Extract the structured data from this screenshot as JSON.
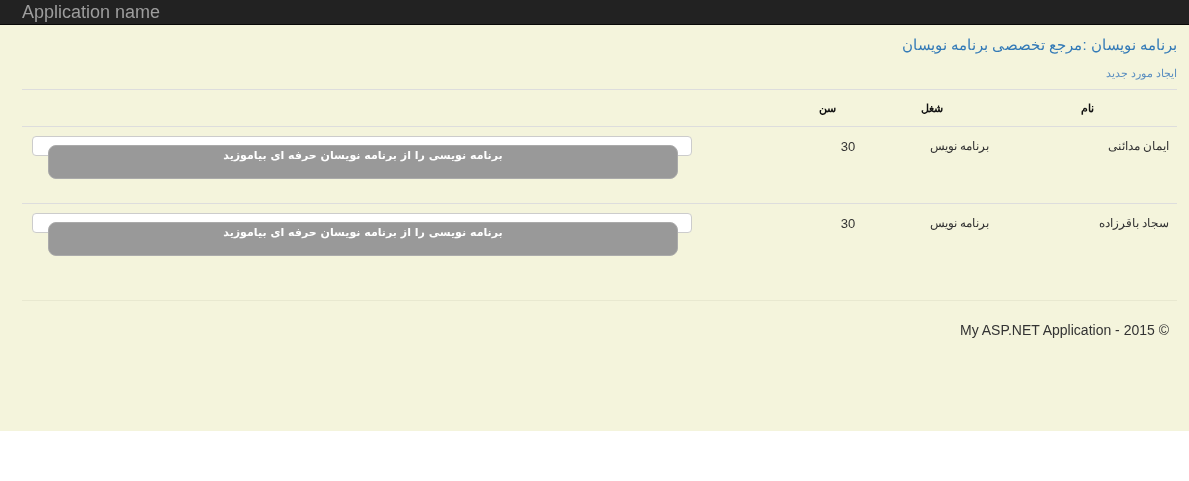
{
  "navbar": {
    "brand": "Application name"
  },
  "page": {
    "title": "برنامه نویسان :مرجع تخصصی برنامه نویسان",
    "create_link": "ایجاد مورد جدید"
  },
  "table": {
    "columns": [
      "نام",
      "شغل",
      "سن"
    ],
    "rows": [
      {
        "name": "ایمان مدائنی",
        "job": "برنامه نویس",
        "age": "30",
        "button": "برنامه نویسی را از برنامه نویسان حرفه ای بیاموزید"
      },
      {
        "name": "سجاد باقرزاده",
        "job": "برنامه نویس",
        "age": "30",
        "button": "برنامه نویسی را از برنامه نویسان حرفه ای بیاموزید"
      }
    ]
  },
  "footer": "My ASP.NET Application - 2015 ©"
}
